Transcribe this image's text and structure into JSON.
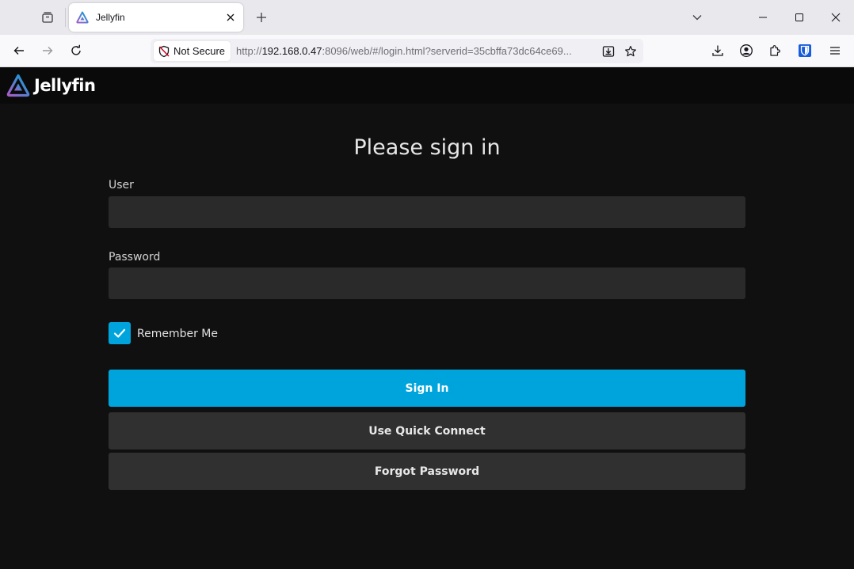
{
  "browser": {
    "tab": {
      "title": "Jellyfin",
      "favicon": "jellyfin-icon"
    },
    "url": {
      "security_label": "Not Secure",
      "scheme": "http://",
      "host": "192.168.0.47",
      "rest": ":8096/web/#/login.html?serverid=35cbffa73dc64ce69...",
      "placeholder": ""
    },
    "icons": [
      "tab-list-icon",
      "close-icon",
      "plus-icon",
      "chevron-down-icon",
      "minimize-icon",
      "maximize-icon",
      "window-close-icon",
      "back-arrow-icon",
      "forward-arrow-icon",
      "reload-icon",
      "shield-slash-icon",
      "save-page-icon",
      "star-icon",
      "download-icon",
      "account-icon",
      "extensions-icon",
      "bitwarden-icon",
      "menu-icon"
    ]
  },
  "app": {
    "logo_text": "Jellyfin",
    "accent_color": "#00a4dc"
  },
  "login": {
    "heading": "Please sign in",
    "user_label": "User",
    "user_value": "",
    "password_label": "Password",
    "password_value": "",
    "remember_me_label": "Remember Me",
    "remember_me_checked": true,
    "sign_in_label": "Sign In",
    "quick_connect_label": "Use Quick Connect",
    "forgot_password_label": "Forgot Password"
  }
}
